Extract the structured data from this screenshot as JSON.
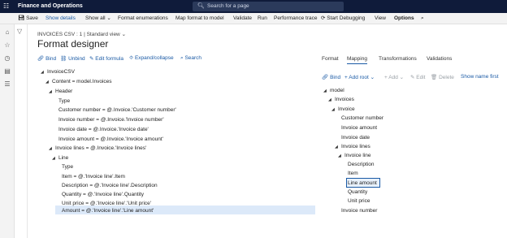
{
  "topbar": {
    "waffle_icon": "waffle-icon",
    "app_title": "Finance and Operations",
    "search_placeholder": "Search for a page",
    "search_icon": "search-icon"
  },
  "actionbar": {
    "save": "Save",
    "show_details": "Show details",
    "show_all": "Show all",
    "format_enumerations": "Format enumerations",
    "map_format_to_model": "Map format to model",
    "validate": "Validate",
    "run": "Run",
    "performance_trace": "Performance trace",
    "start_debugging": "Start Debugging",
    "view": "View",
    "options": "Options"
  },
  "breadcrumb": "INVOICES CSV : 1  |  Standard view",
  "page_title": "Format designer",
  "left_toolbar": {
    "bind": "Bind",
    "unbind": "Unbind",
    "edit_formula": "Edit formula",
    "expand_collapse": "Expand/collapse",
    "search": "Search"
  },
  "right_tabs": [
    "Format",
    "Mapping",
    "Transformations",
    "Validations"
  ],
  "active_tab": "Mapping",
  "mapping_toolbar": {
    "bind": "Bind",
    "add_root": "Add root",
    "add": "Add",
    "edit": "Edit",
    "delete": "Delete",
    "show_name_first": "Show name first"
  },
  "format_tree": [
    "InvoiceCSV",
    "Content = model.Invoices",
    "Header",
    "Type",
    "Customer number = @.Invoice.'Customer number'",
    "Invoice number = @.Invoice.'Invoice number'",
    "Invoice date = @.Invoice.'Invoice date'",
    "Invoice amount = @.Invoice.'Invoice amount'",
    "Invoice lines = @.Invoice.'Invoice lines'",
    "Line",
    "Type",
    "Item = @.'Invoice line'.Item",
    "Description = @.'Invoice line'.Description",
    "Quantity = @.'Invoice line'.Quantity",
    "Unit price = @.'Invoice line'.'Unit price'",
    "Amount = @.'Invoice line'.'Line amount'"
  ],
  "model_tree": [
    "model",
    "Invoices",
    "Invoice",
    "Customer number",
    "Invoice amount",
    "Invoice date",
    "Invoice lines",
    "Invoice line",
    "Description",
    "Item",
    "Line amount",
    "Quantity",
    "Unit price",
    "Invoice number"
  ]
}
